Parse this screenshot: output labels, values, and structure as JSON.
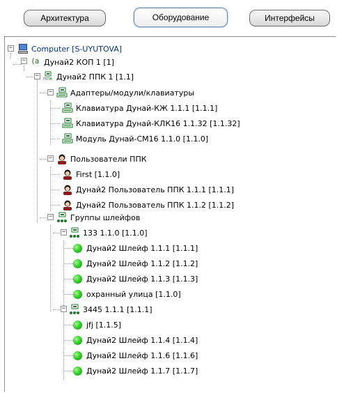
{
  "tabs": [
    {
      "label": "Архитектура",
      "active": false
    },
    {
      "label": "Оборудование",
      "active": true
    },
    {
      "label": "Интерфейсы",
      "active": false
    }
  ],
  "tree": {
    "root": "Computer [S-UYUTOVA]",
    "kop": "Дунай2 КОП 1 [1]",
    "kop_icon_text": "(а",
    "ppk": "Дунай2 ППК 1 [1.1]",
    "ppk_icon_text": "ппк",
    "adapters": "Адаптеры/модули/клавиатуры",
    "keyboard1": "Клавиатура Дунай-КЖ 1.1.1 [1.1.1]",
    "keyboard2": "Клавиатура Дунай-КЛК16 1.1.32 [1.1.32]",
    "module1": "Модуль Дунай-СМ16 1.1.0 [1.1.0]",
    "users": "Пользователи ППК",
    "user1": "First [1.1.0]",
    "user2": "Дунай2 Пользователь ППК 1.1.1 [1.1.1]",
    "user3": "Дунай2 Пользователь ППК 1.1.2 [1.1.2]",
    "groups": "Группы шлейфов",
    "group1": "133 1.1.0 [1.1.0]",
    "loop1": "Дунай2 Шлейф 1.1.1 [1.1.1]",
    "loop2": "Дунай2 Шлейф 1.1.2 [1.1.2]",
    "loop3": "Дунай2 Шлейф 1.1.3 [1.1.3]",
    "loop4": "охранный улица [1.1.0]",
    "group2": "3445 1.1.1 [1.1.1]",
    "loop5": "jfj [1.1.5]",
    "loop6": "Дунай2 Шлейф 1.1.4 [1.1.4]",
    "loop7": "Дунай2 Шлейф 1.1.6 [1.1.6]",
    "loop8": "Дунай2 Шлейф 1.1.7 [1.1.7]"
  }
}
